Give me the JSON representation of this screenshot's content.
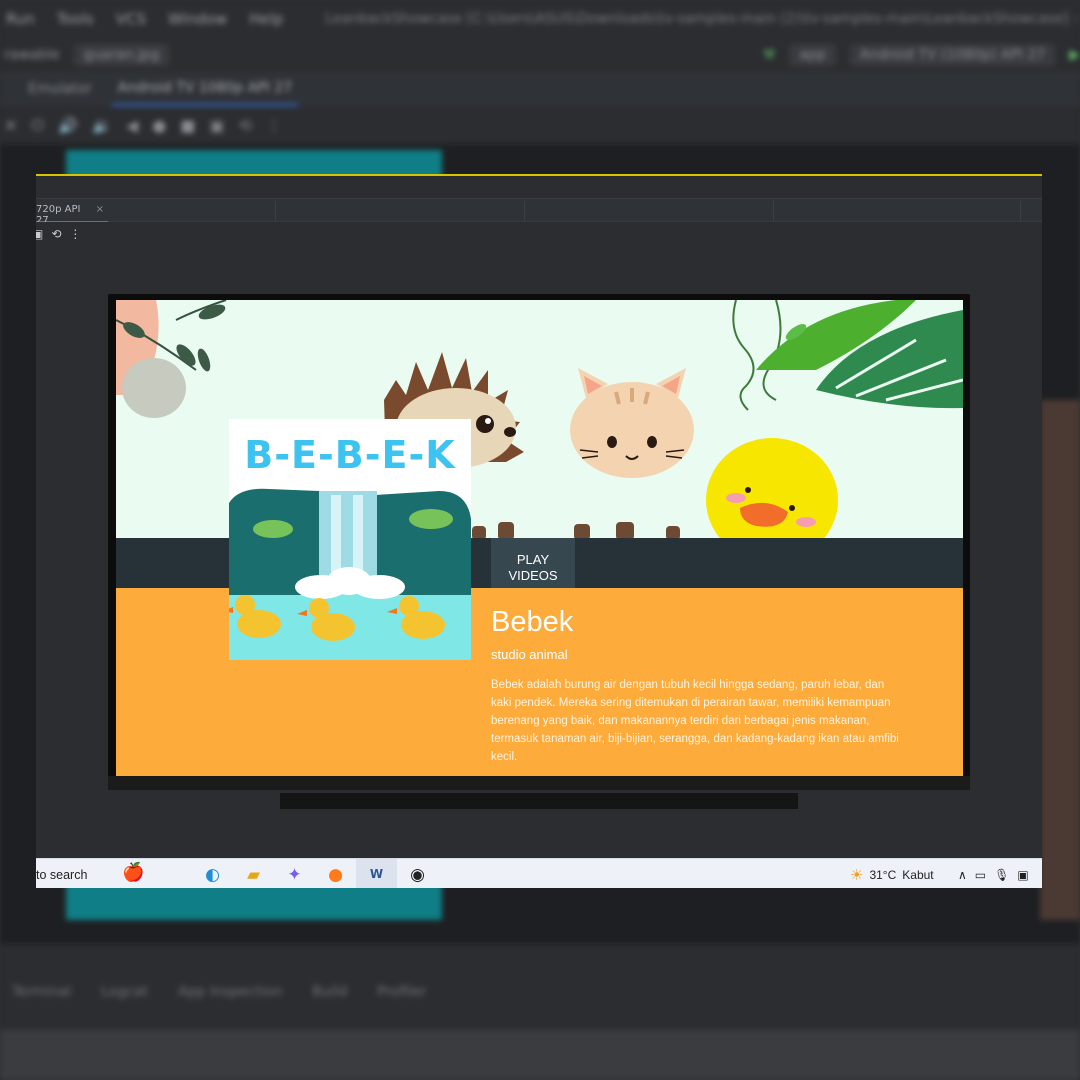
{
  "background_ide": {
    "menu": [
      "Run",
      "Tools",
      "VCS",
      "Window",
      "Help"
    ],
    "window_path": "LeanbackShowcase [C:\\Users\\ASUS\\Downloads\\tv-samples-main (2)\\tv-samples-main\\LeanbackShowcase] - guaran.jpg [L",
    "file_chip": "guaran.jpg",
    "run_config": "app",
    "device": "Android TV (1080p) API 27",
    "tab_emulator": "Emulator",
    "tab_device": "Android TV 1080p API 27",
    "bottom_tools": [
      "Terminal",
      "Logcat",
      "App Inspection",
      "Build",
      "Profiler"
    ]
  },
  "emulator": {
    "tab_label": "720p API 27",
    "tab_close": "×"
  },
  "tv_app": {
    "play_button": "PLAY VIDEOS",
    "poster_title": "B-E-B-E-K",
    "title": "Bebek",
    "subtitle": "studio animal",
    "description": "Bebek adalah burung air dengan tubuh kecil hingga sedang, paruh lebar, dan kaki pendek. Mereka sering ditemukan di perairan tawar, memiliki kemampuan berenang yang baik, dan makanannya terdiri dari berbagai jenis makanan, termasuk tanaman air, biji-bijian, serangga, dan kadang-kadang ikan atau amfibi kecil."
  },
  "taskbar": {
    "search_text": "to search",
    "weather_temp": "31°C",
    "weather_desc": "Kabut"
  },
  "colors": {
    "shelf": "#263238",
    "details": "#fdab3b",
    "hero": "#eafbf2",
    "play_button": "#37474f",
    "accent_blue": "#3574f0"
  }
}
